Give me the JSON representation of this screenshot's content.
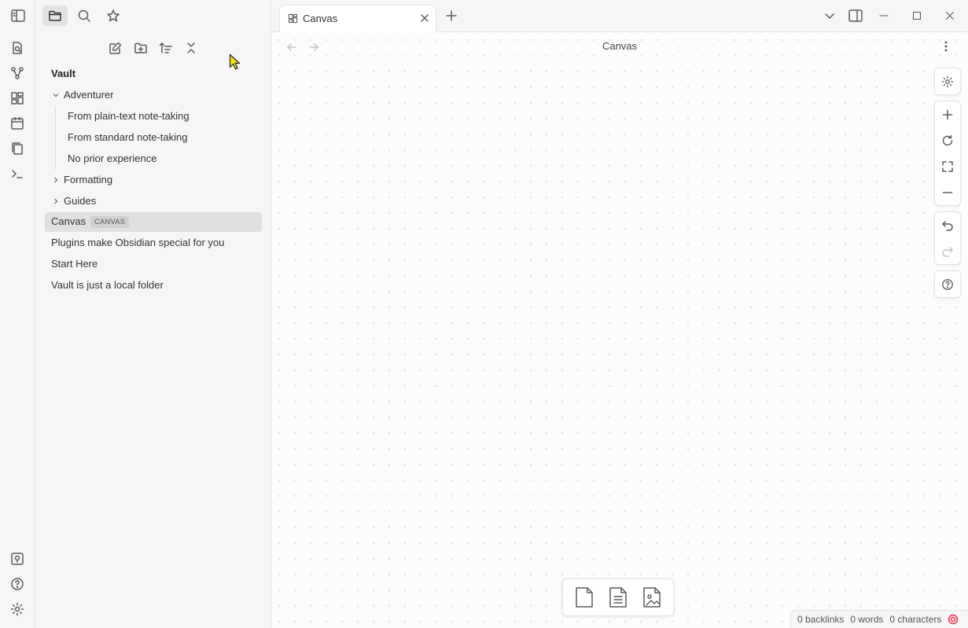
{
  "sidebar": {
    "vault_name": "Vault",
    "tree": {
      "adventurer": {
        "label": "Adventurer",
        "children": [
          "From plain-text note-taking",
          "From standard note-taking",
          "No prior experience"
        ]
      },
      "formatting": "Formatting",
      "guides": "Guides",
      "canvas": {
        "label": "Canvas",
        "badge": "CANVAS"
      },
      "files": [
        "Plugins make Obsidian special for you",
        "Start Here",
        "Vault is just a local folder"
      ]
    }
  },
  "tab": {
    "label": "Canvas"
  },
  "main": {
    "title": "Canvas"
  },
  "status": {
    "backlinks": "0 backlinks",
    "words": "0 words",
    "characters": "0 characters"
  },
  "colors": {
    "accent": "#e93147",
    "selected_bg": "#e0e0e0"
  }
}
